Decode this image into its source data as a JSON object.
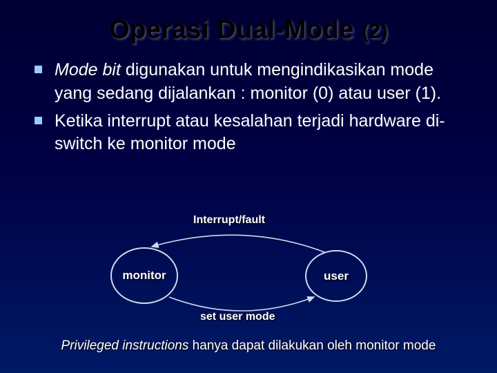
{
  "title": {
    "main": "Operasi Dual-Mode ",
    "sub": "(2)"
  },
  "bullets": [
    {
      "italic_lead": "Mode bit",
      "rest": " digunakan untuk mengindikasikan mode yang sedang dijalankan : monitor (0) atau user (1)."
    },
    {
      "italic_lead": "",
      "rest": "Ketika interrupt atau kesalahan terjadi hardware di-switch ke monitor mode"
    }
  ],
  "diagram": {
    "top_label": "Interrupt/fault",
    "bottom_label": "set user mode",
    "left_node": "monitor",
    "right_node": "user"
  },
  "footer": {
    "italic_lead": "Privileged instructions",
    "rest": " hanya dapat dilakukan oleh monitor mode"
  }
}
